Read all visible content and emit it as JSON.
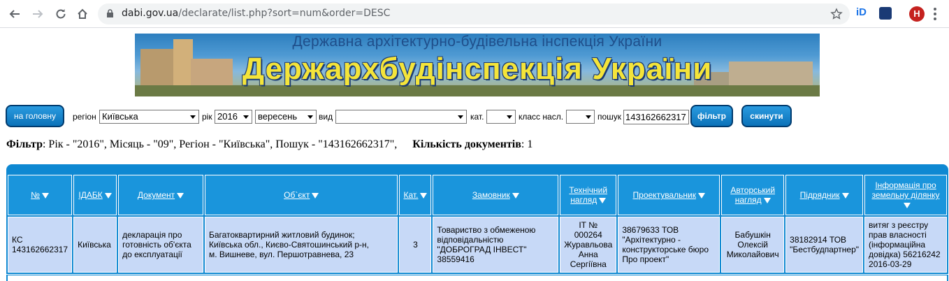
{
  "browser": {
    "url_host": "dabi.gov.ua",
    "url_path": "/declarate/list.php?sort=num&order=DESC",
    "avatar_letter": "Н",
    "ext1_label": "iD"
  },
  "banner": {
    "subtitle": "Державна архітектурно-будівельна інспекція України",
    "title": "Держархбудінспекція України"
  },
  "filters": {
    "home_button": "на головну",
    "region_label": "регіон",
    "region_value": "Київська",
    "year_label": "рік",
    "year_value": "2016",
    "month_value": "вересень",
    "type_label": "вид",
    "type_value": "",
    "cat_label": "кат.",
    "cat_value": "",
    "class_label": "класс насл.",
    "class_value": "",
    "search_label": "пошук",
    "search_value": "143162662317",
    "filter_button": "фільтр",
    "reset_button": "скинути"
  },
  "summary": {
    "filter_label": "Фільтр",
    "filter_text": ": Рік - \"2016\", Місяць - \"09\", Регіон - \"Київська\", Пошук - \"143162662317\",",
    "count_label": "Кількість документів",
    "count_text": ": 1"
  },
  "table": {
    "headers": {
      "num": "№",
      "idabk": "ІДАБК",
      "document": "Документ",
      "object": "Об`єкт",
      "cat": "Кат.",
      "customer": "Замовник",
      "tech_line1": "Технічний",
      "tech_line2": "нагляд",
      "designer": "Проектувальник",
      "author_line1": "Авторський",
      "author_line2": "нагляд",
      "contractor": "Підрядник",
      "land_line1": "Інформація про",
      "land_line2": "земельну ділянку"
    },
    "rows": [
      {
        "num_line1": "КС",
        "num_line2": "143162662317",
        "idabk": "Київська",
        "document_line1": "декларація про",
        "document_line2": "готовність об'єкта",
        "document_line3": "до експлуатації",
        "object_line1": "Багатоквартирний житловий будинок;",
        "object_line2": "Київська обл., Києво-Святошинський р-н,",
        "object_line3": "м. Вишневе, вул. Першотравнева, 23",
        "cat": "3",
        "customer_line1": "Товариство з обмеженою",
        "customer_line2": "відповідальністю",
        "customer_line3": "\"ДОБРОГРАД ІНВЕСТ\"",
        "customer_line4": "38559416",
        "tech_line1": "ІТ № 000264",
        "tech_line2": "Журавльова",
        "tech_line3": "Анна",
        "tech_line4": "Сергіївна",
        "designer_line1": "38679633 ТОВ",
        "designer_line2": "\"Архітектурно -",
        "designer_line3": "конструкторське бюро",
        "designer_line4": "Про проект\"",
        "author_line1": "Бабушкін",
        "author_line2": "Олексій",
        "author_line3": "Миколайович",
        "contractor_line1": "38182914 ТОВ",
        "contractor_line2": "\"Бестбудпартнер\"",
        "land_line1": "витяг з реєстру",
        "land_line2": "прав власності",
        "land_line3": "(інформаційна",
        "land_line4": "довідка) 56216242",
        "land_line5": "2016-03-29"
      }
    ]
  }
}
